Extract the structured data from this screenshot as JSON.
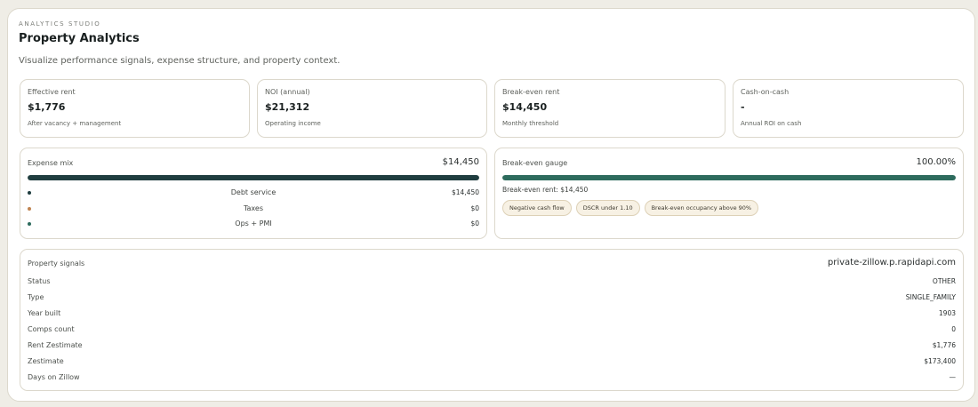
{
  "header": {
    "eyebrow": "ANALYTICS STUDIO",
    "title": "Property Analytics",
    "subtitle": "Visualize performance signals, expense structure, and property context."
  },
  "kpis": [
    {
      "label": "Effective rent",
      "value": "$1,776",
      "note": "After vacancy + management"
    },
    {
      "label": "NOI (annual)",
      "value": "$21,312",
      "note": "Operating income"
    },
    {
      "label": "Break-even rent",
      "value": "$14,450",
      "note": "Monthly threshold"
    },
    {
      "label": "Cash-on-cash",
      "value": "-",
      "note": "Annual ROI on cash"
    }
  ],
  "expense_mix": {
    "label": "Expense mix",
    "total": "$14,450",
    "bar_fill_percent": 100,
    "items": [
      {
        "name": "Debt service",
        "amount": "$14,450",
        "color": "#1f3d3f"
      },
      {
        "name": "Taxes",
        "amount": "$0",
        "color": "#c08450"
      },
      {
        "name": "Ops + PMI",
        "amount": "$0",
        "color": "#2d6b5d"
      }
    ]
  },
  "break_even": {
    "label": "Break-even gauge",
    "percent_text": "100.00%",
    "fill_percent": 100,
    "note": "Break-even rent: $14,450",
    "chips": [
      "Negative cash flow",
      "DSCR under 1.10",
      "Break-even occupancy above 90%"
    ]
  },
  "signals": {
    "label": "Property signals",
    "source": "private-zillow.p.rapidapi.com",
    "rows": [
      {
        "key": "Status",
        "value": "OTHER"
      },
      {
        "key": "Type",
        "value": "SINGLE_FAMILY"
      },
      {
        "key": "Year built",
        "value": "1903"
      },
      {
        "key": "Comps count",
        "value": "0"
      },
      {
        "key": "Rent Zestimate",
        "value": "$1,776"
      },
      {
        "key": "Zestimate",
        "value": "$173,400"
      },
      {
        "key": "Days on Zillow",
        "value": "—"
      }
    ]
  }
}
